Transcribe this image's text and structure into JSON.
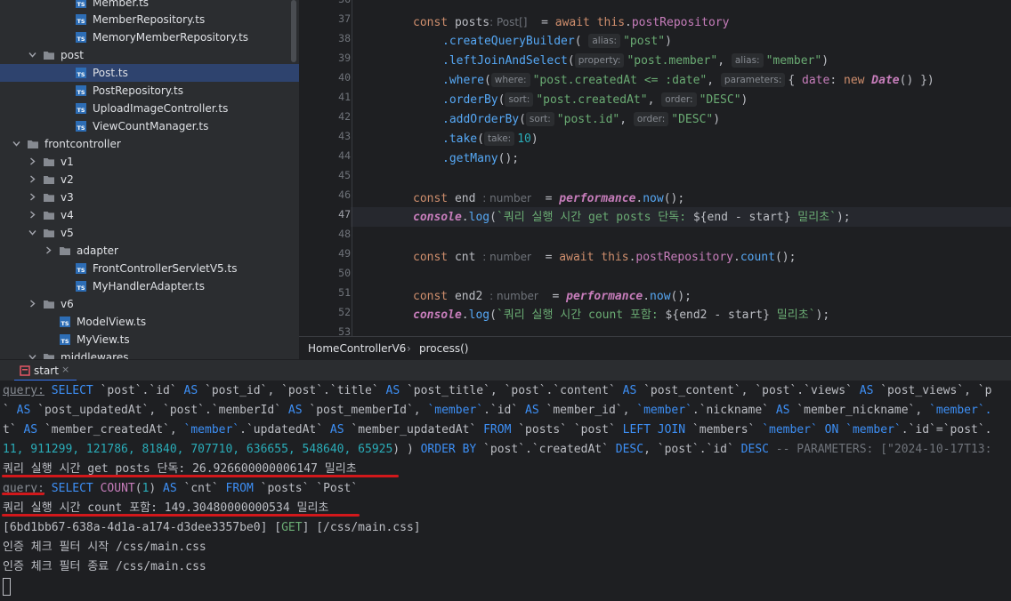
{
  "project_tree": {
    "items": [
      {
        "label": "Member.ts",
        "type": "ts"
      },
      {
        "label": "MemberRepository.ts",
        "type": "ts"
      },
      {
        "label": "MemoryMemberRepository.ts",
        "type": "ts"
      },
      {
        "label": "post",
        "type": "folder"
      },
      {
        "label": "Post.ts",
        "type": "ts"
      },
      {
        "label": "PostRepository.ts",
        "type": "ts"
      },
      {
        "label": "UploadImageController.ts",
        "type": "ts"
      },
      {
        "label": "ViewCountManager.ts",
        "type": "ts"
      },
      {
        "label": "frontcontroller",
        "type": "folder"
      },
      {
        "label": "v1",
        "type": "folder"
      },
      {
        "label": "v2",
        "type": "folder"
      },
      {
        "label": "v3",
        "type": "folder"
      },
      {
        "label": "v4",
        "type": "folder"
      },
      {
        "label": "v5",
        "type": "folder"
      },
      {
        "label": "adapter",
        "type": "folder"
      },
      {
        "label": "FrontControllerServletV5.ts",
        "type": "ts"
      },
      {
        "label": "MyHandlerAdapter.ts",
        "type": "ts"
      },
      {
        "label": "v6",
        "type": "folder"
      },
      {
        "label": "ModelView.ts",
        "type": "ts"
      },
      {
        "label": "MyView.ts",
        "type": "ts"
      },
      {
        "label": "middlewares",
        "type": "folder"
      }
    ]
  },
  "editor": {
    "line_numbers": [
      "36",
      "37",
      "38",
      "39",
      "40",
      "41",
      "42",
      "43",
      "44",
      "45",
      "46",
      "47",
      "48",
      "49",
      "50",
      "51",
      "52",
      "53"
    ],
    "current_line": "47",
    "code": {
      "l37": {
        "kw_const": "const",
        "var": " posts",
        "hint": ": Post[]",
        "eq": "  = ",
        "kw_await": "await",
        "this": " this",
        "dot": ".",
        "prop": "postRepository"
      },
      "l38": {
        "fn": ".createQueryBuilder",
        "open": "(",
        "hint": "alias:",
        "str": "\"post\"",
        "close": ")"
      },
      "l39": {
        "fn": ".leftJoinAndSelect",
        "open": "(",
        "hint1": "property:",
        "str1": "\"post.member\"",
        "comma": ", ",
        "hint2": "alias:",
        "str2": "\"member\"",
        "close": ")"
      },
      "l40": {
        "fn": ".where",
        "open": "(",
        "hint1": "where:",
        "str1": "\"post.createdAt <= :date\"",
        "comma": ", ",
        "hint2": "parameters:",
        "obj_open": "{ ",
        "key": "date",
        "colon": ": ",
        "kw_new": "new",
        "cls": " Date",
        "call": "() })"
      },
      "l41": {
        "fn": ".orderBy",
        "open": "(",
        "hint1": "sort:",
        "str1": "\"post.createdAt\"",
        "comma": ", ",
        "hint2": "order:",
        "str2": "\"DESC\"",
        "close": ")"
      },
      "l42": {
        "fn": ".addOrderBy",
        "open": "(",
        "hint1": "sort:",
        "str1": "\"post.id\"",
        "comma": ", ",
        "hint2": "order:",
        "str2": "\"DESC\"",
        "close": ")"
      },
      "l43": {
        "fn": ".take",
        "open": "(",
        "hint": "take:",
        "num": "10",
        "close": ")"
      },
      "l44": {
        "fn": ".getMany",
        "close": "();"
      },
      "l46": {
        "kw_const": "const",
        "var": " end",
        "hint": ": number",
        "eq": "  = ",
        "glob": "performance",
        "dot": ".",
        "fn": "now",
        "close": "();"
      },
      "l47": {
        "glob": "console",
        "dot": ".",
        "fn": "log",
        "open": "(",
        "str_start": "`쿼리 실행 시간 get posts 단독: ",
        "tmpl": "${end - start}",
        "str_end": " 밀리초`",
        "close": ");"
      },
      "l49": {
        "kw_const": "const",
        "var": " cnt",
        "hint": ": number",
        "eq": "  = ",
        "kw_await": "await",
        "this": " this",
        "dot": ".",
        "prop": "postRepository",
        "dot2": ".",
        "fn": "count",
        "close": "();"
      },
      "l51": {
        "kw_const": "const",
        "var": " end2",
        "hint": ": number",
        "eq": "  = ",
        "glob": "performance",
        "dot": ".",
        "fn": "now",
        "close": "();"
      },
      "l52": {
        "glob": "console",
        "dot": ".",
        "fn": "log",
        "open": "(",
        "str_start": "`쿼리 실행 시간 count 포함: ",
        "tmpl": "${end2 - start}",
        "str_end": " 밀리초`",
        "close": ");"
      }
    }
  },
  "breadcrumb": {
    "file": "HomeControllerV6",
    "sep": "›",
    "method": "process()"
  },
  "run_panel": {
    "tab_label": "start",
    "close_glyph": "×",
    "lines": {
      "l1": {
        "q": "query:",
        "a": " SELECT ",
        "b": "`post`.`id`",
        "c": " AS ",
        "d": "`post_id`, ",
        "e": "`post`.`title`",
        "f": " AS ",
        "g": "`post_title`, ",
        "h": "`post`.`content`",
        "i": " AS ",
        "j": "`post_content`, ",
        "k": "`post`.`views`",
        "l": " AS ",
        "m": "`post_views`, `p"
      },
      "l2": {
        "a": "` ",
        "b": "AS",
        "c": " `post_updatedAt`, `post`.`memberId` ",
        "d": "AS",
        "e": " `post_memberId`, ",
        "f": "`member`",
        "g": ".`id` ",
        "h": "AS",
        "i": " `member_id`, ",
        "j": "`member`",
        "k": ".`nickname` ",
        "l": "AS",
        "m": " `member_nickname`, ",
        "n": "`member`."
      },
      "l3": {
        "a": "t` ",
        "b": "AS",
        "c": " `member_createdAt`, ",
        "d": "`member`",
        "e": ".`updatedAt` ",
        "f": "AS",
        "g": " `member_updatedAt` ",
        "h": "FROM",
        "i": " `posts` `post` ",
        "j": "LEFT JOIN",
        "k": " `members` ",
        "l": "`member`",
        "m": " ON ",
        "n": "`member`",
        "o": ".`id`=`post`."
      },
      "l4": {
        "a": "11, 911299, 121786, 81840, 707710, 636655, 548640, 65925",
        "b": ") ) ",
        "c": "ORDER BY",
        "d": " `post`.`createdAt` ",
        "e": "DESC",
        "f": ", `post`.`id` ",
        "g": "DESC",
        "h": " -- PARAMETERS: [\"2024-10-17T13:"
      },
      "l5": "쿼리 실행 시간 get posts 단독: 26.926600000006147 밀리초",
      "l6": {
        "q": "query:",
        "a": " SELECT ",
        "b": "COUNT",
        "c": "(",
        "d": "1",
        "e": ") ",
        "f": "AS",
        "g": " `cnt` ",
        "h": "FROM",
        "i": " `posts` `Post`"
      },
      "l7": "쿼리 실행 시간 count 포함: 149.30480000000534 밀리초",
      "l8": {
        "a": "[6bd1bb67-638a-4d1a-a174-d3dee3357be0] [",
        "b": "GET",
        "c": "] [/css/main.css]"
      },
      "l9": "인증 체크 필터 시작 /css/main.css",
      "l10": "인증 체크 필터 종료 /css/main.css"
    }
  },
  "colors": {
    "selection": "#2e436e",
    "underline": "#d2181b",
    "accent": "#3574f0"
  }
}
